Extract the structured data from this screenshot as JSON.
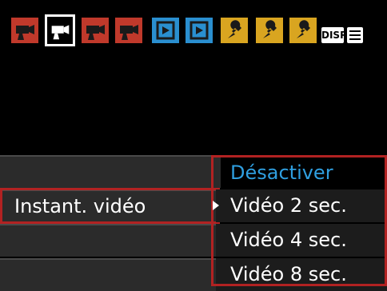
{
  "tabs": [
    {
      "icon": "movie-camera-icon",
      "color": "#c0392b",
      "selected": false
    },
    {
      "icon": "movie-camera-icon",
      "color": "#c0392b",
      "selected": true
    },
    {
      "icon": "movie-camera-icon",
      "color": "#c0392b",
      "selected": false
    },
    {
      "icon": "movie-camera-icon",
      "color": "#c0392b",
      "selected": false
    },
    {
      "icon": "playback-icon",
      "color": "#2a8fd0",
      "selected": false
    },
    {
      "icon": "playback-icon",
      "color": "#2a8fd0",
      "selected": false
    },
    {
      "icon": "wrench-icon",
      "color": "#d9a520",
      "selected": false
    },
    {
      "icon": "wrench-icon",
      "color": "#d9a520",
      "selected": false
    },
    {
      "icon": "wrench-icon",
      "color": "#d9a520",
      "selected": false
    }
  ],
  "header": {
    "disp_label": "DISP"
  },
  "menu": {
    "selected_item_label": "Instant. vidéo",
    "options": [
      "Désactiver",
      "Vidéo 2 sec.",
      "Vidéo 4 sec.",
      "Vidéo 8 sec."
    ],
    "current_option_index": 1,
    "highlight_color": "#2f9fe0",
    "selection_border_color": "#b22222"
  }
}
